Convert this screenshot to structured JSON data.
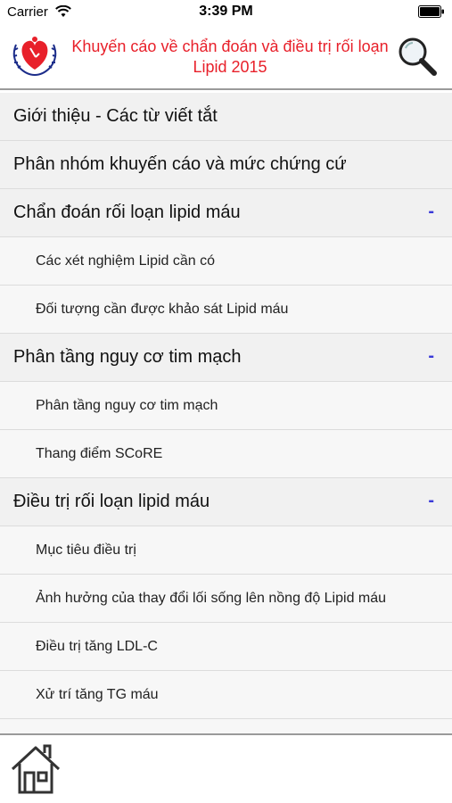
{
  "status_bar": {
    "carrier": "Carrier",
    "time": "3:39 PM"
  },
  "header": {
    "title_line1": "Khuyến cáo về chẩn đoán và điều trị rối loạn",
    "title_line2": "Lipid 2015",
    "title_color": "#e8202a"
  },
  "menu": {
    "toggle_symbol": "-",
    "items": [
      {
        "label": "Giới thiệu - Các từ viết tắt",
        "level": 0
      },
      {
        "label": "Phân nhóm khuyến cáo và mức chứng cứ",
        "level": 0
      },
      {
        "label": "Chẩn đoán rối loạn lipid máu",
        "level": 0,
        "expanded": true
      },
      {
        "label": "Các xét nghiệm Lipid cần có",
        "level": 1
      },
      {
        "label": "Đối tượng cần được khảo sát Lipid máu",
        "level": 1
      },
      {
        "label": "Phân tầng nguy cơ tim mạch",
        "level": 0,
        "expanded": true
      },
      {
        "label": "Phân tầng nguy cơ tim mạch",
        "level": 1
      },
      {
        "label": "Thang điểm SCoRE",
        "level": 1
      },
      {
        "label": "Điều trị rối loạn lipid máu",
        "level": 0,
        "expanded": true
      },
      {
        "label": "Mục tiêu điều trị",
        "level": 1
      },
      {
        "label": "Ảnh hưởng của thay đổi lối sống lên nồng độ Lipid máu",
        "level": 1
      },
      {
        "label": "Điều trị tăng LDL-C",
        "level": 1
      },
      {
        "label": "Xử trí tăng TG máu",
        "level": 1
      }
    ]
  },
  "toolbar": {
    "home_icon": "home-icon"
  },
  "colors": {
    "accent_toggle": "#3a3ad8",
    "row_background": "#f1f1f1",
    "divider": "#9a9a9a"
  }
}
